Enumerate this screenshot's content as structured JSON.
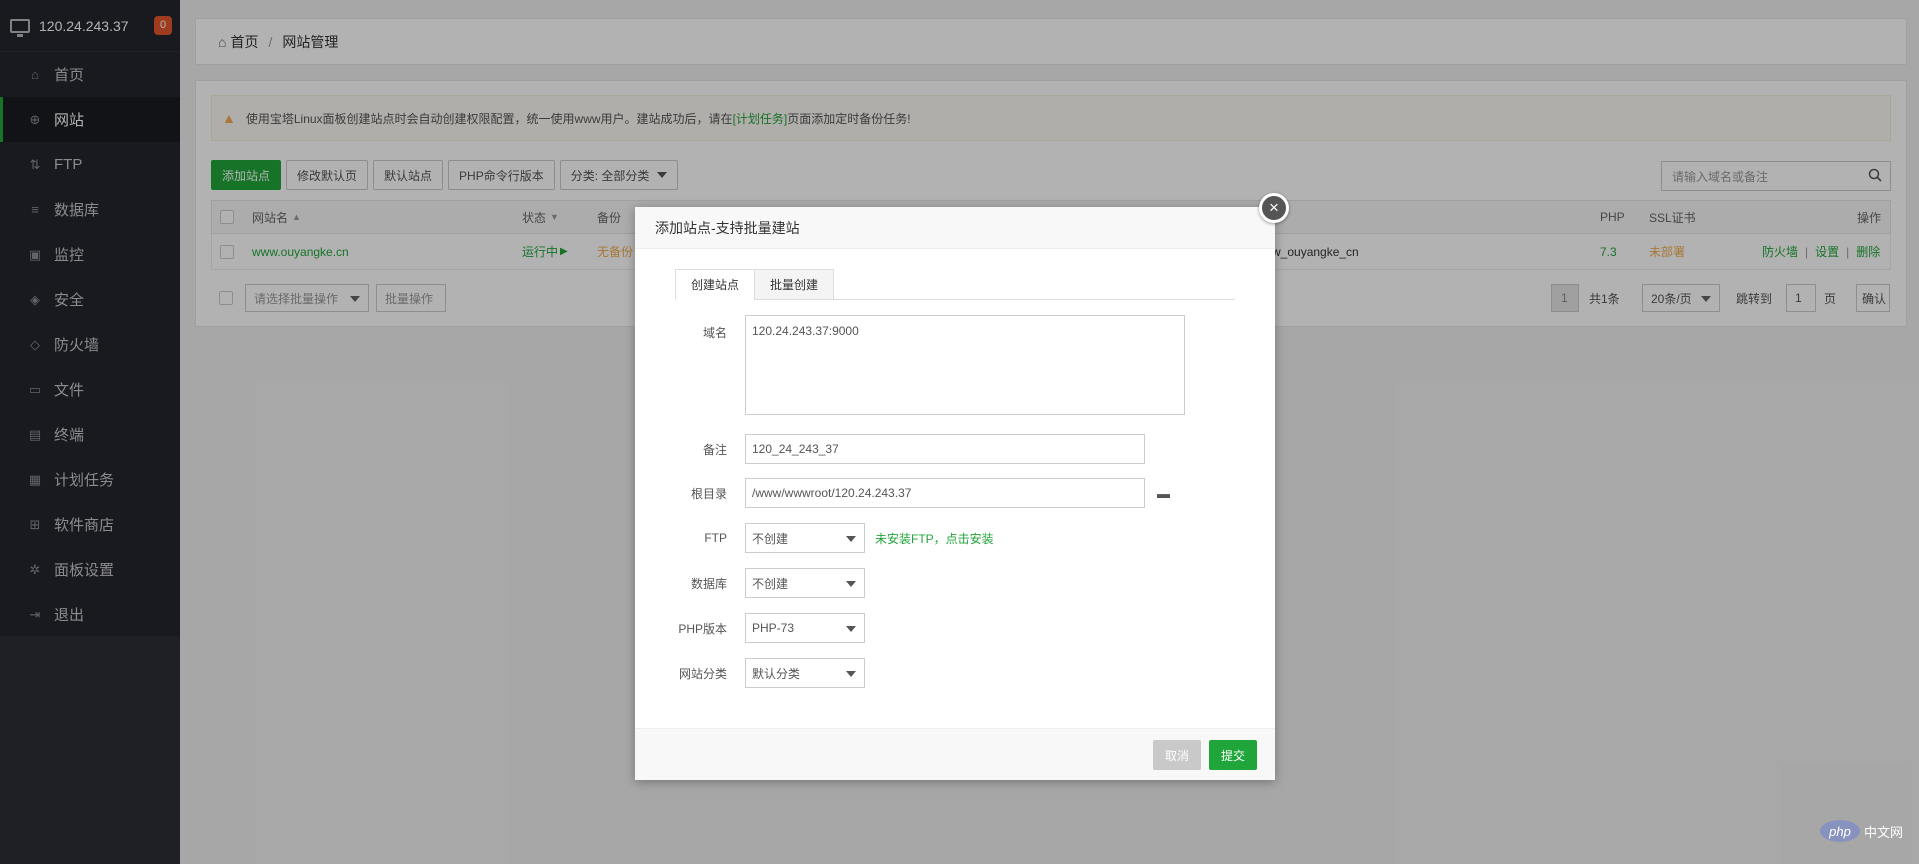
{
  "sidebar": {
    "host": "120.24.243.37",
    "badge": "0",
    "items": [
      {
        "label": "首页",
        "icon": "home-icon"
      },
      {
        "label": "网站",
        "icon": "globe-icon",
        "active": true
      },
      {
        "label": "FTP",
        "icon": "ftp-icon"
      },
      {
        "label": "数据库",
        "icon": "database-icon"
      },
      {
        "label": "监控",
        "icon": "monitor-icon"
      },
      {
        "label": "安全",
        "icon": "shield-icon"
      },
      {
        "label": "防火墙",
        "icon": "firewall-icon"
      },
      {
        "label": "文件",
        "icon": "folder-icon"
      },
      {
        "label": "终端",
        "icon": "terminal-icon"
      },
      {
        "label": "计划任务",
        "icon": "calendar-icon"
      },
      {
        "label": "软件商店",
        "icon": "grid-icon"
      },
      {
        "label": "面板设置",
        "icon": "gear-icon"
      },
      {
        "label": "退出",
        "icon": "logout-icon"
      }
    ]
  },
  "breadcrumb": {
    "home": "首页",
    "sep": "/",
    "current": "网站管理"
  },
  "notice": {
    "pre": "使用宝塔Linux面板创建站点时会自动创建权限配置，统一使用www用户。建站成功后，请在",
    "link": "[计划任务]",
    "post": "页面添加定时备份任务!"
  },
  "toolbar": {
    "add_site": "添加站点",
    "modify_default_page": "修改默认页",
    "default_site": "默认站点",
    "php_cli": "PHP命令行版本",
    "category": "分类: 全部分类"
  },
  "search": {
    "placeholder": "请输入域名或备注"
  },
  "table": {
    "headers": {
      "name": "网站名",
      "status": "状态",
      "backup": "备份",
      "php": "PHP",
      "ssl": "SSL证书",
      "ops": "操作"
    },
    "rows": [
      {
        "name": "www.ouyangke.cn",
        "status": "运行中",
        "backup": "无备份",
        "remark": "w_ouyangke_cn",
        "php": "7.3",
        "ssl": "未部署",
        "op_firewall": "防火墙",
        "op_settings": "设置",
        "op_delete": "删除",
        "op_sep": "|"
      }
    ]
  },
  "footer": {
    "batch_placeholder": "请选择批量操作",
    "batch_btn": "批量操作",
    "page": "1",
    "total": "共1条",
    "per_page": "20条/页",
    "jump": "跳转到",
    "jump_value": "1",
    "page_unit": "页",
    "confirm": "确认"
  },
  "modal": {
    "title": "添加站点-支持批量建站",
    "close": "×",
    "tabs": [
      "创建站点",
      "批量创建"
    ],
    "domain_label": "域名",
    "domain_value": "120.24.243.37:9000",
    "remark_label": "备注",
    "remark_value": "120_24_243_37",
    "root_label": "根目录",
    "root_value": "/www/wwwroot/120.24.243.37",
    "ftp_label": "FTP",
    "ftp_value": "不创建",
    "ftp_hint": "未安装FTP，点击安装",
    "db_label": "数据库",
    "db_value": "不创建",
    "php_label": "PHP版本",
    "php_value": "PHP-73",
    "cat_label": "网站分类",
    "cat_value": "默认分类",
    "cancel": "取消",
    "submit": "提交"
  },
  "watermark": {
    "logo": "php",
    "text": "中文网"
  },
  "colors": {
    "accent": "#20a53a",
    "sidebar": "#23262e",
    "warning": "#f0ad4e",
    "badge": "#e4572e"
  }
}
